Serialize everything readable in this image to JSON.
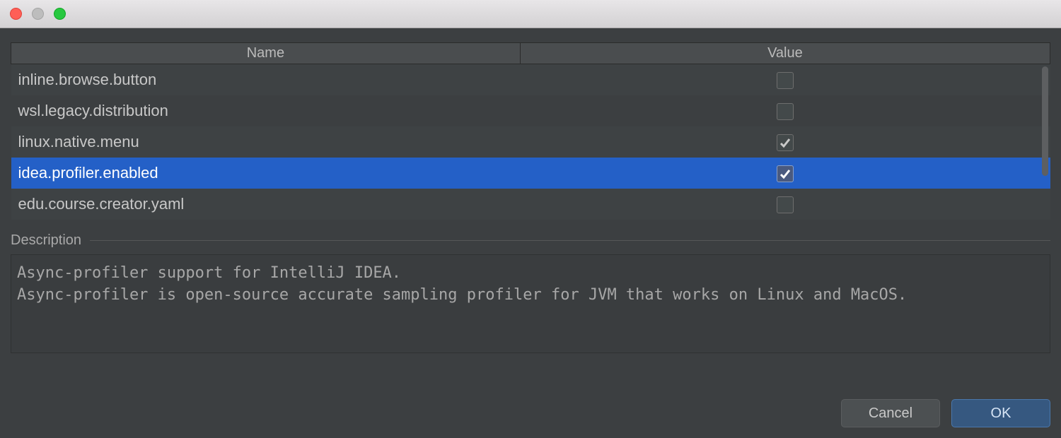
{
  "columns": {
    "name": "Name",
    "value": "Value"
  },
  "rows": [
    {
      "name": "inline.browse.button",
      "checked": false,
      "selected": false
    },
    {
      "name": "wsl.legacy.distribution",
      "checked": false,
      "selected": false
    },
    {
      "name": "linux.native.menu",
      "checked": true,
      "selected": false
    },
    {
      "name": "idea.profiler.enabled",
      "checked": true,
      "selected": true
    },
    {
      "name": "edu.course.creator.yaml",
      "checked": false,
      "selected": false
    }
  ],
  "section_label": "Description",
  "description": "Async-profiler support for IntelliJ IDEA.\nAsync-profiler is open-source accurate sampling profiler for JVM that works on Linux and MacOS.",
  "buttons": {
    "cancel": "Cancel",
    "ok": "OK"
  }
}
